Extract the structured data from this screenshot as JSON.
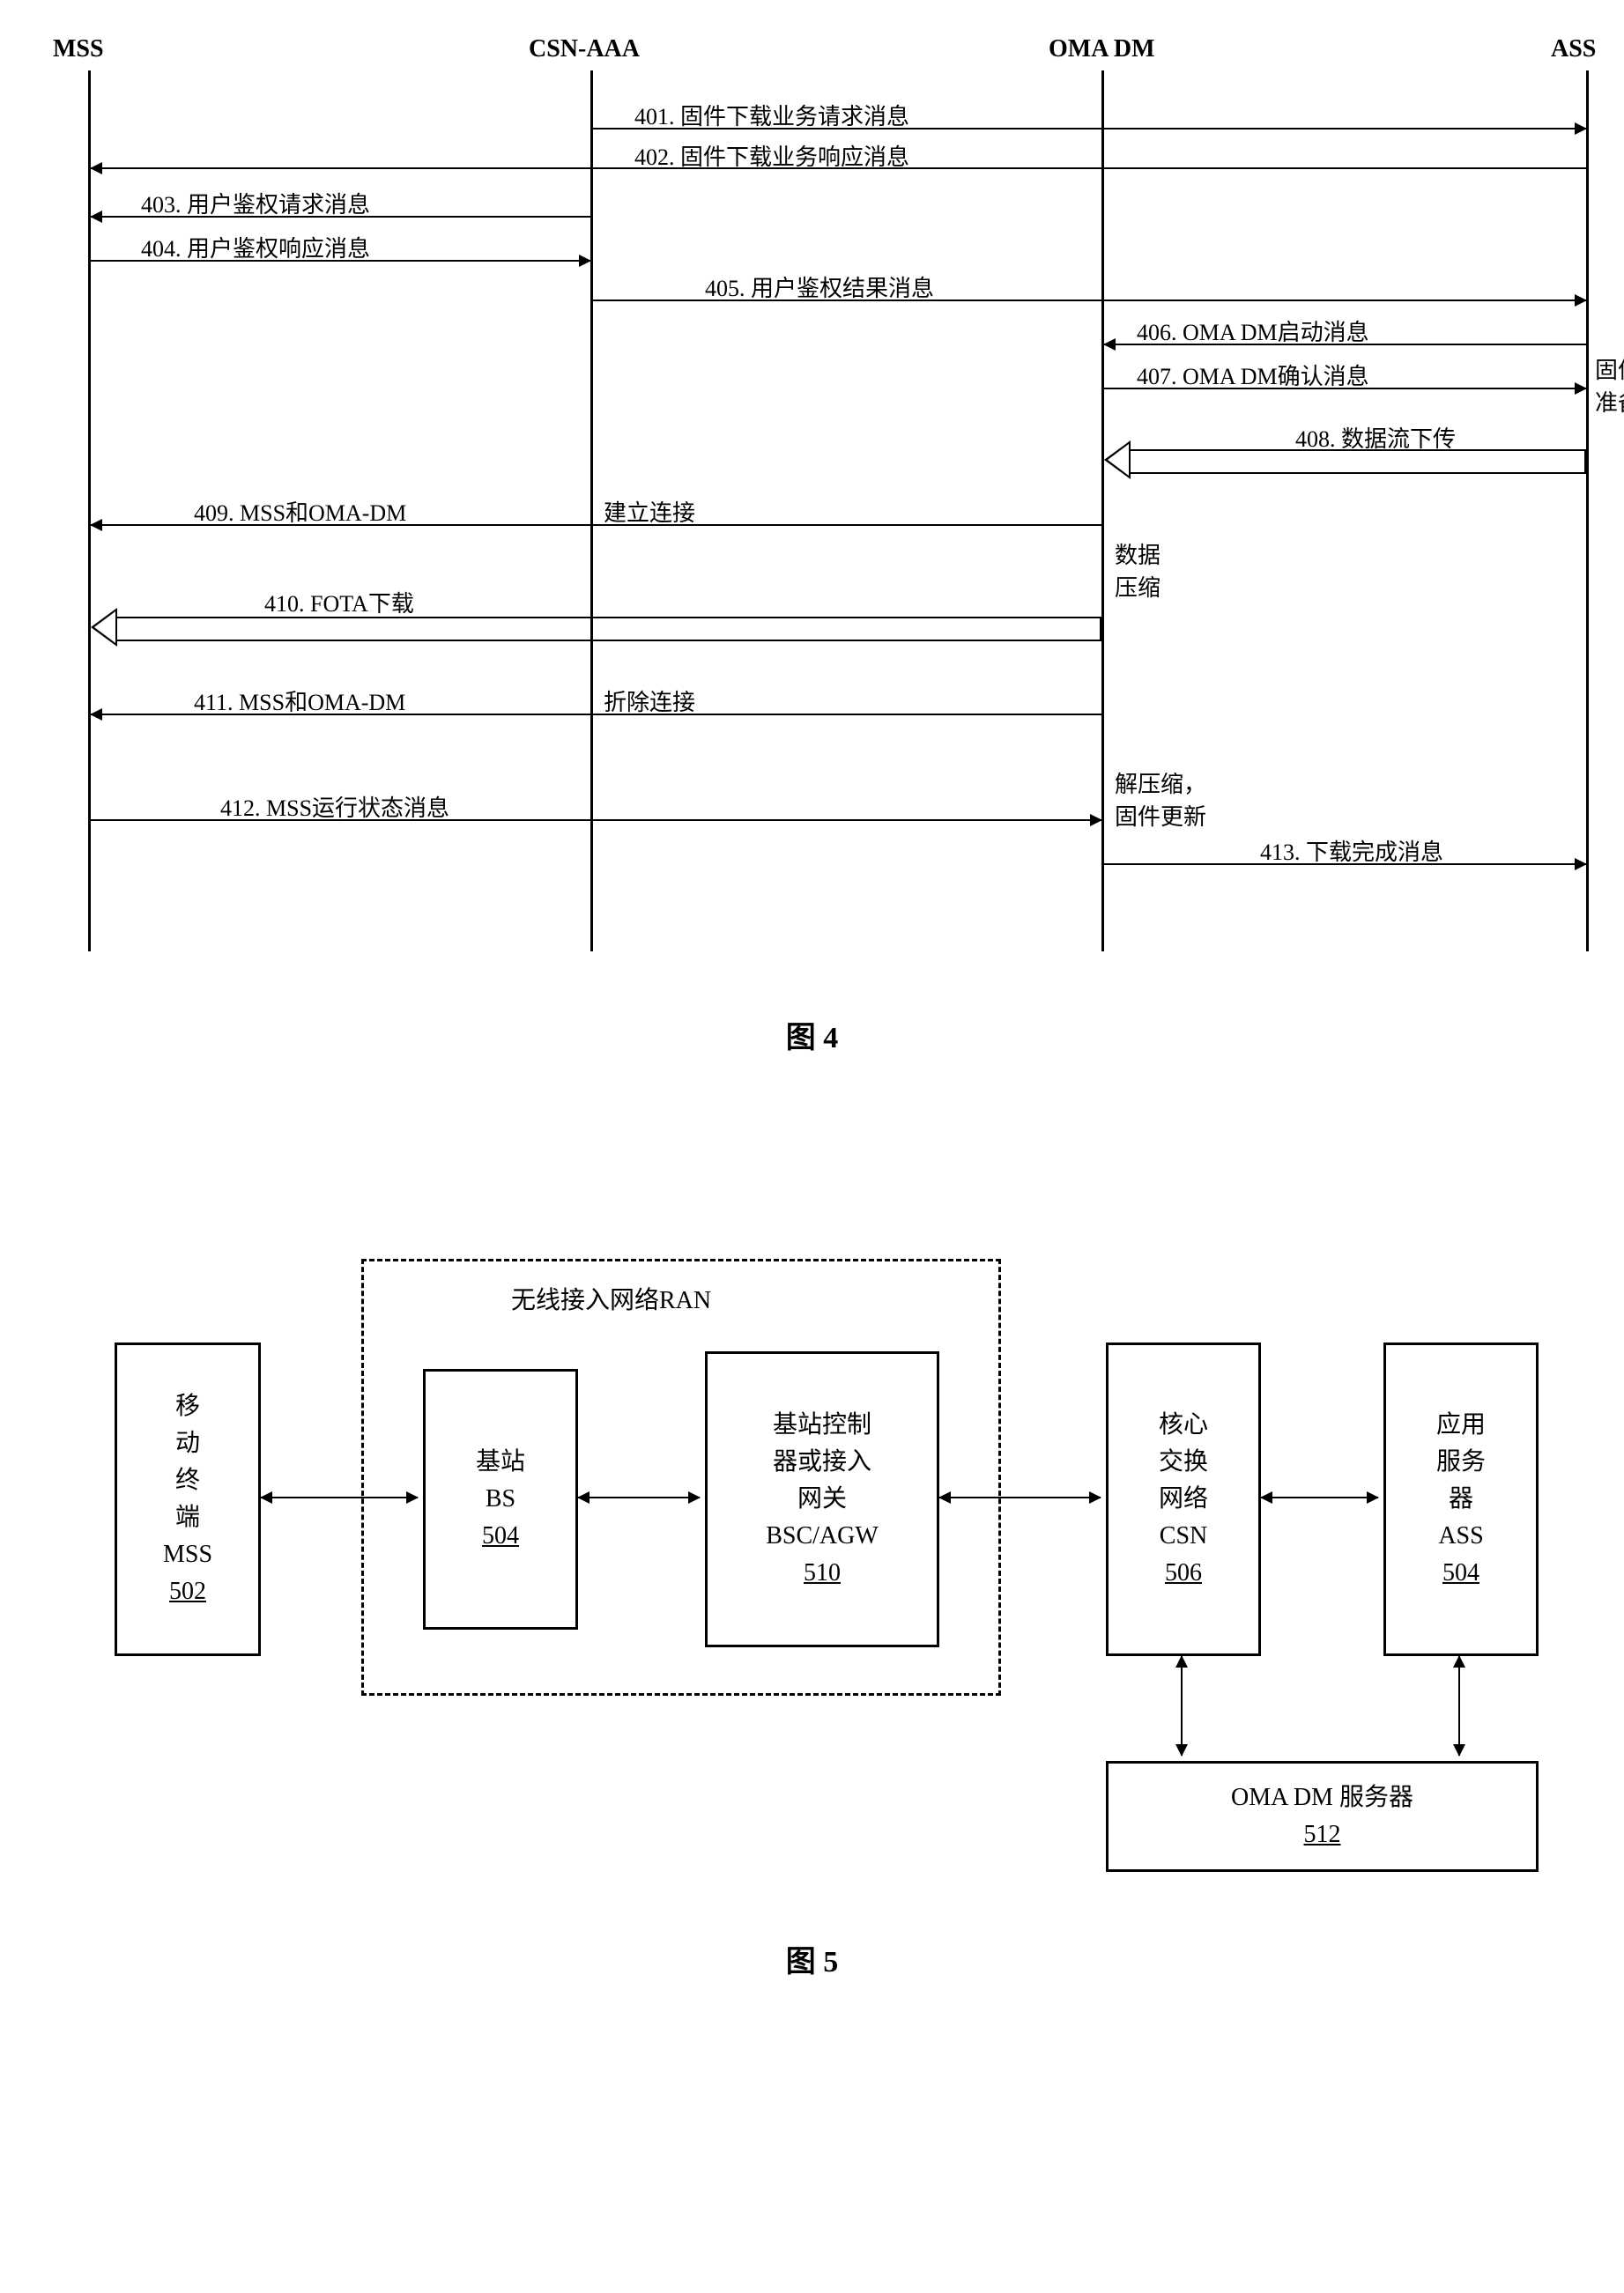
{
  "fig4": {
    "participants": {
      "mss": "MSS",
      "csn": "CSN-AAA",
      "oma": "OMA DM",
      "ass": "ASS"
    },
    "messages": {
      "m401": "401. 固件下载业务请求消息",
      "m402": "402. 固件下载业务响应消息",
      "m403": "403. 用户鉴权请求消息",
      "m404": "404. 用户鉴权响应消息",
      "m405": "405. 用户鉴权结果消息",
      "m406": "406. OMA DM启动消息",
      "m407": "407. OMA DM确认消息",
      "m408": "408. 数据流下传",
      "m409a": "409. MSS和OMA-DM",
      "m409b": "建立连接",
      "m410": "410. FOTA下载",
      "m411a": "411. MSS和OMA-DM",
      "m411b": "折除连接",
      "m412": "412. MSS运行状态消息",
      "m413": "413. 下载完成消息"
    },
    "notes": {
      "fw_prep": "固件\n准备",
      "data_compress": "数据\n压缩",
      "decompress": "解压缩，\n固件更新"
    },
    "caption": "图 4"
  },
  "fig5": {
    "ran_label": "无线接入网络RAN",
    "boxes": {
      "mss": {
        "lines": [
          "移",
          "动",
          "终",
          "端",
          "MSS"
        ],
        "id": "502"
      },
      "bs": {
        "lines": [
          "基站",
          "BS"
        ],
        "id": "504"
      },
      "bsc": {
        "lines": [
          "基站控制",
          "器或接入",
          "网关",
          "BSC/AGW"
        ],
        "id": "510"
      },
      "csn": {
        "lines": [
          "核心",
          "交换",
          "网络",
          "CSN"
        ],
        "id": "506"
      },
      "ass": {
        "lines": [
          "应用",
          "服务",
          "器",
          "ASS"
        ],
        "id": "504"
      },
      "oma": {
        "lines": [
          "OMA DM 服务器"
        ],
        "id": "512"
      }
    },
    "caption": "图 5"
  }
}
